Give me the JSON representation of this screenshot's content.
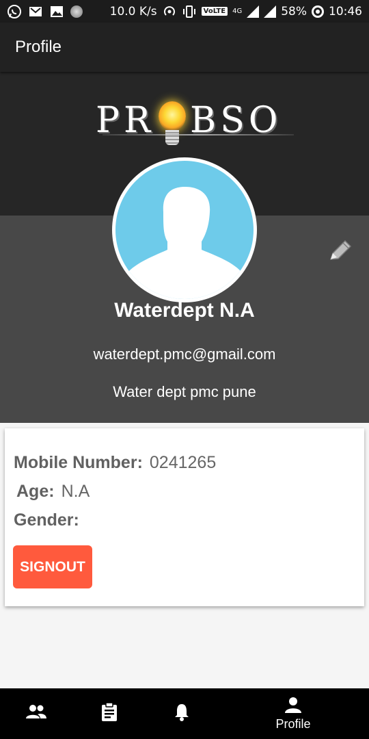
{
  "status_bar": {
    "network_speed": "10.0 K/s",
    "volte": "VoLTE",
    "network_type": "4G",
    "battery": "58%",
    "time": "10:46"
  },
  "app_bar": {
    "title": "Profile"
  },
  "header": {
    "logo_text": "PROBSO",
    "name": "Waterdept N.A",
    "email": "waterdept.pmc@gmail.com",
    "address": "Water dept pmc pune"
  },
  "details": {
    "mobile_label": "Mobile Number:",
    "mobile_value": "0241265",
    "age_label": "Age:",
    "age_value": "N.A",
    "gender_label": "Gender:",
    "gender_value": ""
  },
  "signout_label": "SIGNOUT",
  "bottom_nav": {
    "items": [
      {
        "icon": "people-icon",
        "label": ""
      },
      {
        "icon": "clipboard-icon",
        "label": ""
      },
      {
        "icon": "bell-icon",
        "label": ""
      },
      {
        "icon": "person-icon",
        "label": "Profile"
      }
    ]
  },
  "colors": {
    "app_bar": "#222222",
    "header_gray": "#484848",
    "avatar_bg": "#6ecbea",
    "signout": "#ff5a3d"
  }
}
